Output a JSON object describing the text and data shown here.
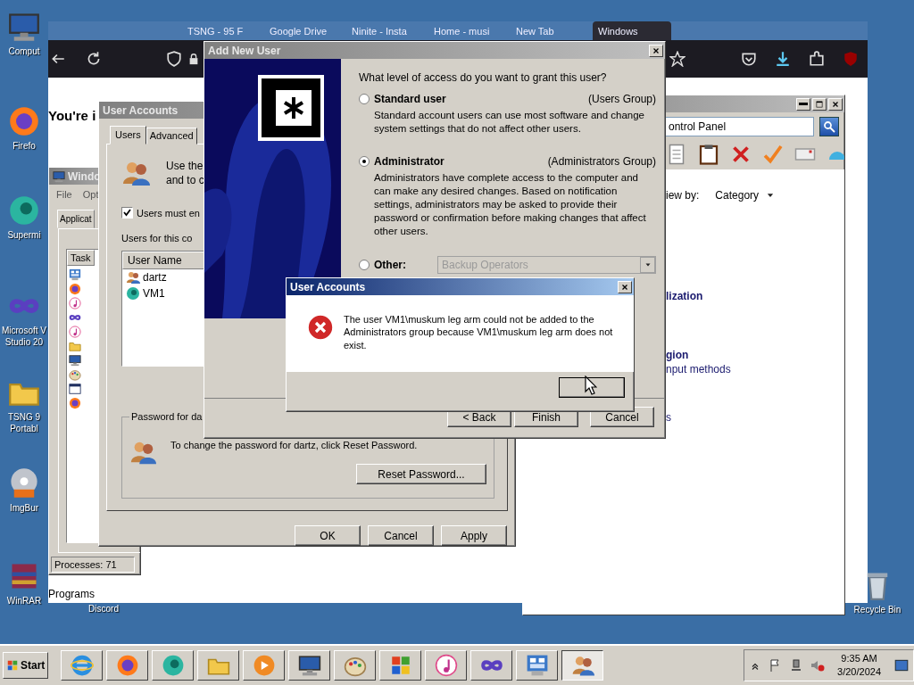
{
  "desktop_icons": [
    {
      "label": "Comput"
    },
    {
      "label": "Firefo"
    },
    {
      "label": "Supermi"
    },
    {
      "label": "Microsoft V\nStudio 20"
    },
    {
      "label": "TSNG 9\nPortabl"
    },
    {
      "label": "ImgBur"
    },
    {
      "label": "WinRAR"
    }
  ],
  "discord_label": "Discord",
  "recycle_bin": {
    "label": "Recycle Bin"
  },
  "browser": {
    "tabs": [
      {
        "label": "TSNG - 95 F",
        "selected": false
      },
      {
        "label": "Google Drive",
        "selected": false
      },
      {
        "label": "Ninite - Insta",
        "selected": false
      },
      {
        "label": "Home - musi",
        "selected": false
      },
      {
        "label": "New Tab",
        "selected": false
      },
      {
        "label": "Windows",
        "selected": true
      }
    ],
    "heading": "You're i",
    "footer_text": "Programs"
  },
  "task_manager": {
    "title": "Windo",
    "menu": [
      "File",
      "Opt"
    ],
    "tab": "Applicat",
    "column": "Task",
    "status": "Processes: 71"
  },
  "control_panel": {
    "search": "ontrol Panel",
    "view_by_label": "iew by:",
    "view_by_value": "Category",
    "entries": [
      {
        "text": "lization",
        "kind": "heading"
      },
      {
        "text": "gion",
        "kind": "heading"
      },
      {
        "text": "nput methods",
        "kind": "link"
      },
      {
        "text": "s",
        "kind": "link"
      }
    ]
  },
  "user_accounts": {
    "title": "User Accounts",
    "tabs": [
      {
        "label": "Users",
        "selected": true
      },
      {
        "label": "Advanced",
        "selected": false
      }
    ],
    "intro": [
      "Use the",
      "and to c"
    ],
    "must_enter": {
      "label": "Users must en",
      "checked": true
    },
    "users_label": "Users for this co",
    "column": "User Name",
    "users": [
      {
        "name": "dartz",
        "selected": false
      },
      {
        "name": "VM1",
        "selected": false
      }
    ],
    "password_group": "Password for da",
    "password_text": "To change the password for dartz, click Reset Password.",
    "reset_button": "Reset Password...",
    "buttons": [
      "OK",
      "Cancel",
      "Apply"
    ]
  },
  "wizard": {
    "title": "Add New User",
    "question": "What level of access do you want to grant this user?",
    "options": [
      {
        "kind": "radio",
        "label": "Standard user",
        "group": "(Users Group)",
        "description": "Standard account users can use most software and change system settings that do not affect other users.",
        "selected": false
      },
      {
        "kind": "radio",
        "label": "Administrator",
        "group": "(Administrators Group)",
        "description": "Administrators have complete access to the computer and can make any desired changes. Based on notification settings, administrators may be asked to provide their password or confirmation before making changes that affect other users.",
        "selected": true
      },
      {
        "kind": "dropdown",
        "label": "Other:",
        "value": "Backup Operators",
        "selected": false
      }
    ],
    "buttons": [
      "< Back",
      "Finish",
      "Cancel"
    ]
  },
  "error_dialog": {
    "title": "User Accounts",
    "message": "The user VM1\\muskum leg arm could not be added to the Administrators group because VM1\\muskum leg arm does not exist."
  },
  "taskbar": {
    "start": "Start",
    "apps": [
      {
        "selected": false
      },
      {
        "selected": false
      },
      {
        "selected": false
      },
      {
        "selected": false
      },
      {
        "selected": false
      },
      {
        "selected": false
      },
      {
        "selected": false
      },
      {
        "selected": false
      },
      {
        "selected": false
      },
      {
        "selected": false
      },
      {
        "selected": false
      },
      {
        "selected": true
      }
    ],
    "time": "9:35 AM",
    "date": "3/20/2024"
  }
}
